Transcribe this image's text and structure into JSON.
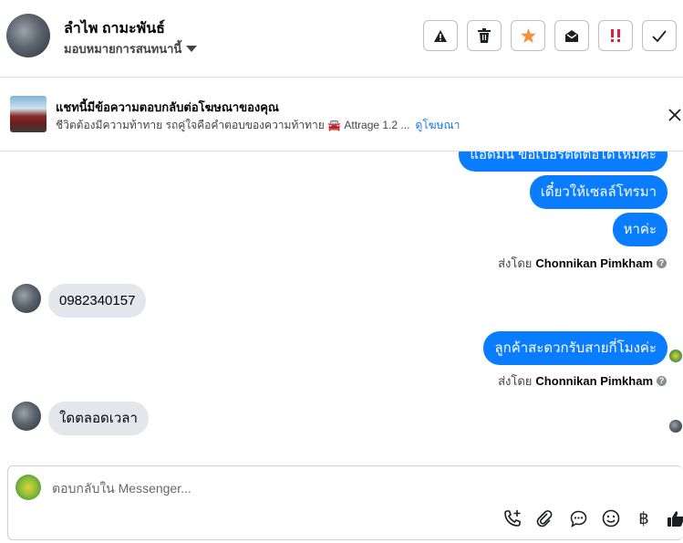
{
  "header": {
    "contact_name": "ลำไพ ถามะพันธ์",
    "assign_label": "มอบหมายการสนทนานี้",
    "actions": [
      {
        "name": "spam-button",
        "icon": "warning-icon"
      },
      {
        "name": "delete-button",
        "icon": "trash-icon"
      },
      {
        "name": "star-button",
        "icon": "star-icon"
      },
      {
        "name": "mark-unread-button",
        "icon": "envelope-open-icon"
      },
      {
        "name": "priority-button",
        "icon": "double-exclamation-icon"
      },
      {
        "name": "done-button",
        "icon": "checkmark-icon"
      }
    ],
    "colors": {
      "star": "#f7923a",
      "priority": "#e41e3f"
    }
  },
  "ad_banner": {
    "title": "แชทนี้มีข้อความตอบกลับต่อโฆษณาของคุณ",
    "subtitle": "ชีวิตต้องมีความท้าทาย รถคู่ใจคือคำตอบของความท้าทาย 🚘 Attrage 1.2 ...",
    "link_label": "ดูโฆษณา"
  },
  "messages": [
    {
      "direction": "out",
      "text": "แอดมิน ขอเบอร์ติดต่อได้ไหมคะ"
    },
    {
      "direction": "out",
      "text": "เดี๋ยวให้เซลล์โทรมา"
    },
    {
      "direction": "out",
      "text": "หาค่ะ"
    },
    {
      "direction": "in",
      "text": "0982340157"
    },
    {
      "direction": "out",
      "text": "ลูกค้าสะดวกรับสายกี่โมงค่ะ"
    },
    {
      "direction": "in",
      "text": "ใดตลอดเวลา"
    }
  ],
  "sent_by": {
    "prefix": "ส่งโดย",
    "name": "Chonnikan Pimkham",
    "help": "?"
  },
  "composer": {
    "placeholder": "ตอบกลับใน Messenger...",
    "tools": [
      "phone-add-icon",
      "paperclip-icon",
      "chat-bubble-icon",
      "emoji-icon",
      "baht-icon",
      "thumbs-up-icon"
    ],
    "currency_glyph": "฿"
  },
  "colors": {
    "accent": "#0a7cff",
    "link": "#1877f2",
    "incoming": "#e4e6eb"
  }
}
